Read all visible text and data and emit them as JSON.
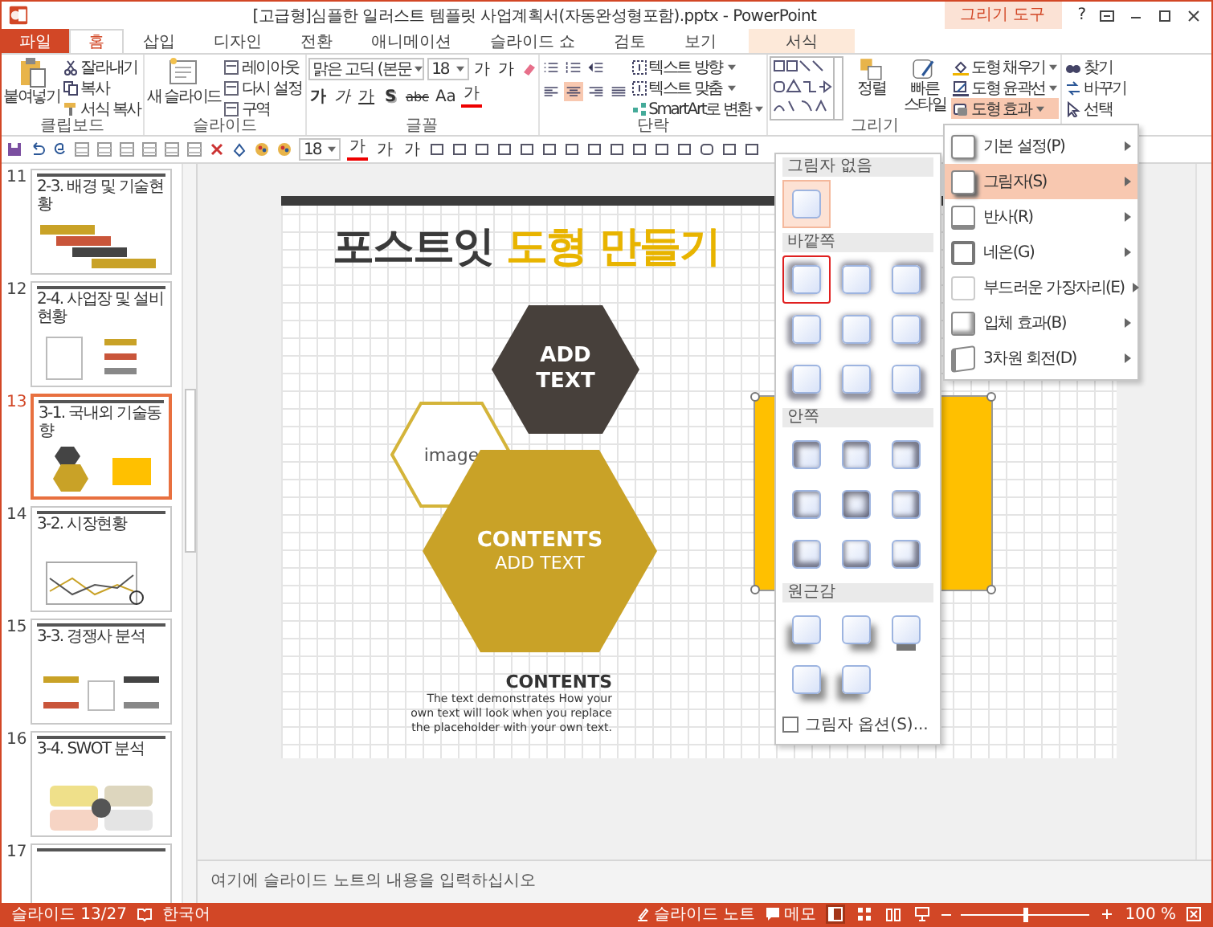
{
  "window": {
    "title": "[고급형]심플한 일러스트 템플릿 사업계획서(자동완성형포함).pptx - PowerPoint",
    "context_label": "그리기 도구",
    "help": "?"
  },
  "tabs": [
    {
      "label": "파일",
      "kind": "file",
      "selected": false
    },
    {
      "label": "홈",
      "kind": "normal",
      "selected": true
    },
    {
      "label": "삽입",
      "kind": "normal",
      "selected": false
    },
    {
      "label": "디자인",
      "kind": "normal",
      "selected": false
    },
    {
      "label": "전환",
      "kind": "normal",
      "selected": false
    },
    {
      "label": "애니메이션",
      "kind": "normal",
      "selected": false
    },
    {
      "label": "슬라이드 쇼",
      "kind": "normal",
      "selected": false
    },
    {
      "label": "검토",
      "kind": "normal",
      "selected": false
    },
    {
      "label": "보기",
      "kind": "normal",
      "selected": false
    },
    {
      "label": "서식",
      "kind": "context",
      "selected": false
    }
  ],
  "clipboard": {
    "label": "클립보드",
    "paste": "붙여넣기",
    "items": [
      "잘라내기",
      "복사",
      "서식 복사"
    ]
  },
  "slides_group": {
    "label": "슬라이드",
    "new_slide": "새 슬라이드",
    "items": [
      "레이아웃",
      "다시 설정",
      "구역"
    ]
  },
  "font": {
    "label": "글꼴",
    "font_name": "맑은 고딕 (본문",
    "font_size": "18",
    "grow": "가",
    "shrink": "가",
    "formats": [
      {
        "label": "가",
        "kind": "bold"
      },
      {
        "label": "가",
        "kind": "italic"
      },
      {
        "label": "가",
        "kind": "underline"
      },
      {
        "label": "S",
        "kind": "shadow"
      },
      {
        "label": "abc",
        "kind": "strike"
      },
      {
        "label": "Aa",
        "kind": "case"
      },
      {
        "label": "가",
        "kind": "color"
      }
    ]
  },
  "paragraph": {
    "label": "단락",
    "alignments": [
      {
        "kind": "left",
        "selected": false
      },
      {
        "kind": "center",
        "selected": true
      },
      {
        "kind": "right",
        "selected": false
      },
      {
        "kind": "justify",
        "selected": false
      }
    ],
    "text_tools": [
      "텍스트 방향",
      "텍스트 맞춤",
      "SmartArt로 변환"
    ]
  },
  "drawing": {
    "label": "그리기",
    "arrange": "정렬",
    "quick_styles": "빠른 스타일",
    "items": [
      {
        "label": "도형 채우기",
        "selected": false
      },
      {
        "label": "도형 윤곽선",
        "selected": false
      },
      {
        "label": "도형 효과",
        "selected": true
      }
    ]
  },
  "editing": {
    "items": [
      "찾기",
      "바꾸기",
      "선택"
    ]
  },
  "quick_access": {
    "font_size": "18",
    "font_color": "가",
    "grow": "가",
    "shrink": "가"
  },
  "thumbnails": [
    {
      "number": "11",
      "title": "2-3. 배경 및 기술현황",
      "kind": "banners",
      "selected": false
    },
    {
      "number": "12",
      "title": "2-4. 사업장 및 설비현황",
      "kind": "diagram",
      "selected": false
    },
    {
      "number": "13",
      "title": "3-1. 국내외 기술동향",
      "kind": "hexagons",
      "selected": true
    },
    {
      "number": "14",
      "title": "3-2. 시장현황",
      "kind": "chart",
      "selected": false
    },
    {
      "number": "15",
      "title": "3-3. 경쟁사 분석",
      "kind": "compare",
      "selected": false
    },
    {
      "number": "16",
      "title": "3-4. SWOT 분석",
      "kind": "swot",
      "selected": false
    },
    {
      "number": "17",
      "kind": "plain",
      "selected": false
    }
  ],
  "slide": {
    "title": [
      {
        "text": "포스트잇",
        "accent": false
      },
      {
        "text": "도형 만들기",
        "accent": true
      }
    ],
    "dark_hexagon": "ADD TEXT",
    "image_hexagon": "image",
    "gold_hexagon": {
      "heading": "CONTENTS",
      "text": "ADD TEXT"
    },
    "caption": {
      "heading": "CONTENTS",
      "body": "The text demonstrates How your own text will look when you replace the placeholder with your own text."
    },
    "rectangle_selected": true
  },
  "effects_menu": {
    "items": [
      {
        "label": "기본 설정(P)",
        "kind": "preset",
        "selected": false
      },
      {
        "label": "그림자(S)",
        "kind": "shadow",
        "selected": true
      },
      {
        "label": "반사(R)",
        "kind": "reflection",
        "selected": false
      },
      {
        "label": "네온(G)",
        "kind": "glow",
        "selected": false
      },
      {
        "label": "부드러운 가장자리(E)",
        "kind": "soft",
        "selected": false
      },
      {
        "label": "입체 효과(B)",
        "kind": "bevel",
        "selected": false
      },
      {
        "label": "3차원 회전(D)",
        "kind": "rotate",
        "selected": false
      }
    ]
  },
  "shadow_gallery": {
    "sections": [
      {
        "title": "그림자 없음",
        "kind": "none",
        "tiles": [
          {
            "selected": false,
            "hovered": true
          }
        ]
      },
      {
        "title": "바깥쪽",
        "kind": "outer",
        "tiles": [
          {
            "selected": true,
            "hovered": false
          },
          {
            "selected": false,
            "hovered": false
          },
          {
            "selected": false,
            "hovered": false
          },
          {
            "selected": false,
            "hovered": false
          },
          {
            "selected": false,
            "hovered": false
          },
          {
            "selected": false,
            "hovered": false
          },
          {
            "selected": false,
            "hovered": false
          },
          {
            "selected": false,
            "hovered": false
          },
          {
            "selected": false,
            "hovered": false
          }
        ]
      },
      {
        "title": "안쪽",
        "kind": "inner",
        "tiles": [
          {
            "selected": false,
            "hovered": false
          },
          {
            "selected": false,
            "hovered": false
          },
          {
            "selected": false,
            "hovered": false
          },
          {
            "selected": false,
            "hovered": false
          },
          {
            "selected": false,
            "hovered": false
          },
          {
            "selected": false,
            "hovered": false
          },
          {
            "selected": false,
            "hovered": false
          },
          {
            "selected": false,
            "hovered": false
          },
          {
            "selected": false,
            "hovered": false
          }
        ]
      },
      {
        "title": "원근감",
        "kind": "perspective",
        "tiles": [
          {
            "selected": false,
            "hovered": false
          },
          {
            "selected": false,
            "hovered": false
          },
          {
            "selected": false,
            "hovered": false
          },
          {
            "selected": false,
            "hovered": false
          },
          {
            "selected": false,
            "hovered": false
          }
        ]
      }
    ],
    "options": "그림자 옵션(S)..."
  },
  "notes": {
    "placeholder": "여기에 슬라이드 노트의 내용을 입력하십시오"
  },
  "status_bar": {
    "slide": "슬라이드 13/27",
    "language": "한국어",
    "notes": "슬라이드 노트",
    "comments": "메모",
    "views": [
      {
        "kind": "normal",
        "selected": true
      },
      {
        "kind": "sorter",
        "selected": false
      },
      {
        "kind": "reading",
        "selected": false
      },
      {
        "kind": "show",
        "selected": false
      }
    ],
    "zoom": "100 %",
    "level": 0.5
  }
}
